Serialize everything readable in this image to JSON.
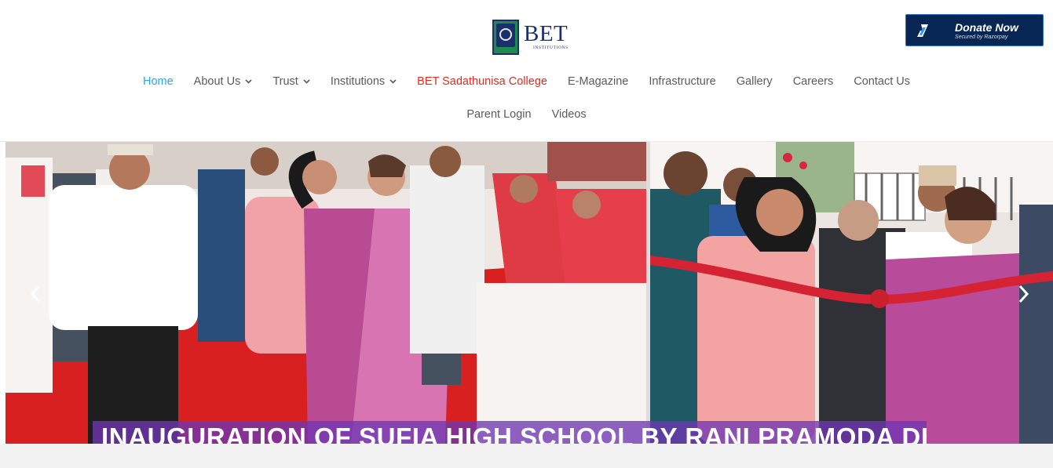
{
  "logo": {
    "title": "BET",
    "subtitle": "INSTITUTIONS"
  },
  "donate": {
    "title": "Donate Now",
    "subtitle": "Secured by Razorpay",
    "icon": "razorpay-icon"
  },
  "nav": {
    "row1": [
      {
        "label": "Home",
        "state": "active"
      },
      {
        "label": "About Us",
        "dropdown": true
      },
      {
        "label": "Trust",
        "dropdown": true
      },
      {
        "label": "Institutions",
        "dropdown": true
      },
      {
        "label": "BET Sadathunisa College",
        "state": "highlight"
      },
      {
        "label": "E-Magazine"
      },
      {
        "label": "Infrastructure"
      },
      {
        "label": "Gallery"
      },
      {
        "label": "Careers"
      },
      {
        "label": "Contact Us"
      }
    ],
    "row2": [
      {
        "label": "Parent Login"
      },
      {
        "label": "Videos"
      }
    ]
  },
  "slider": {
    "caption": "INAUGURATION OF SUFIA HIGH SCHOOL BY RANI PRAMODA DEVI",
    "prev_icon": "chevron-left-icon",
    "next_icon": "chevron-right-icon"
  },
  "colors": {
    "nav_text": "#5b5b5b",
    "nav_active": "#2ea3f2",
    "nav_highlight": "#e02b20",
    "donate_bg": "#072654",
    "caption_bg": "#7036b2",
    "brand_navy": "#1a2f6e",
    "brand_green": "#1f8a4c"
  }
}
